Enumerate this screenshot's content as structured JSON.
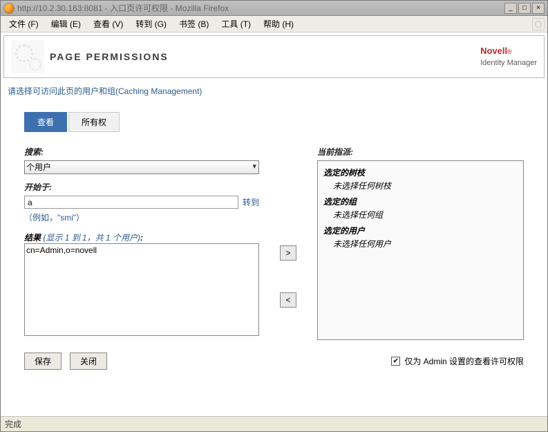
{
  "window": {
    "url_title": "http://10.2.30.163:8081 - 入口页许可权限 - Mozilla Firefox",
    "min": "_",
    "max": "□",
    "close": "×"
  },
  "menu": {
    "file": "文件 (F)",
    "edit": "编辑 (E)",
    "view": "查看 (V)",
    "go": "转到 (G)",
    "bookmarks": "书签 (B)",
    "tools": "工具 (T)",
    "help": "帮助 (H)"
  },
  "brand": {
    "name": "Novell",
    "reg": "®",
    "sub": "Identity Manager"
  },
  "page": {
    "title": "PAGE PERMISSIONS",
    "instruction": "请选择可访问此页的用户和组(Caching Management)"
  },
  "tabs": {
    "view": "查看",
    "owner": "所有权"
  },
  "search": {
    "label": "搜索:",
    "type_selected": "个用户",
    "starts_label": "开始于:",
    "starts_value": "a",
    "go_link": "转到",
    "hint": "（例如，\"smi\"）",
    "results_prefix": "结果",
    "results_info": "(显示 1 到 1，共 1 个用户)",
    "results_colon": ":",
    "result_item": "cn=Admin,o=novell"
  },
  "transfer": {
    "add": ">",
    "remove": "<"
  },
  "assign": {
    "label": "当前指派:",
    "sec_container": "选定的树枝",
    "sec_container_none": "未选择任何树枝",
    "sec_group": "选定的组",
    "sec_group_none": "未选择任何组",
    "sec_user": "选定的用户",
    "sec_user_none": "未选择任何用户"
  },
  "buttons": {
    "save": "保存",
    "close": "关闭"
  },
  "checkbox": {
    "label": "仅为 Admin 设置的查看许可权限"
  },
  "status": "完成"
}
